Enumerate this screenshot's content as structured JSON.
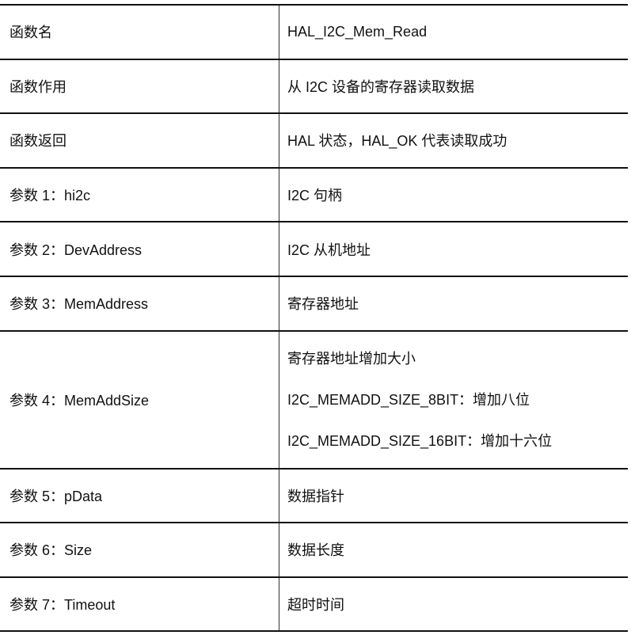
{
  "rows": [
    {
      "param": "函数名",
      "desc": [
        "HAL_I2C_Mem_Read"
      ]
    },
    {
      "param": "函数作用",
      "desc": [
        "从 I2C 设备的寄存器读取数据"
      ]
    },
    {
      "param": "函数返回",
      "desc": [
        "HAL 状态，HAL_OK 代表读取成功"
      ]
    },
    {
      "param": "参数 1：hi2c",
      "desc": [
        "I2C 句柄"
      ]
    },
    {
      "param": "参数 2：DevAddress",
      "desc": [
        "I2C 从机地址"
      ]
    },
    {
      "param": "参数 3：MemAddress",
      "desc": [
        "寄存器地址"
      ]
    },
    {
      "param": "参数 4：MemAddSize",
      "desc": [
        "寄存器地址增加大小",
        "I2C_MEMADD_SIZE_8BIT：增加八位",
        "I2C_MEMADD_SIZE_16BIT：增加十六位"
      ]
    },
    {
      "param": "参数 5：pData",
      "desc": [
        "数据指针"
      ]
    },
    {
      "param": "参数 6：Size",
      "desc": [
        "数据长度"
      ]
    },
    {
      "param": "参数 7：Timeout",
      "desc": [
        "超时时间"
      ]
    }
  ]
}
